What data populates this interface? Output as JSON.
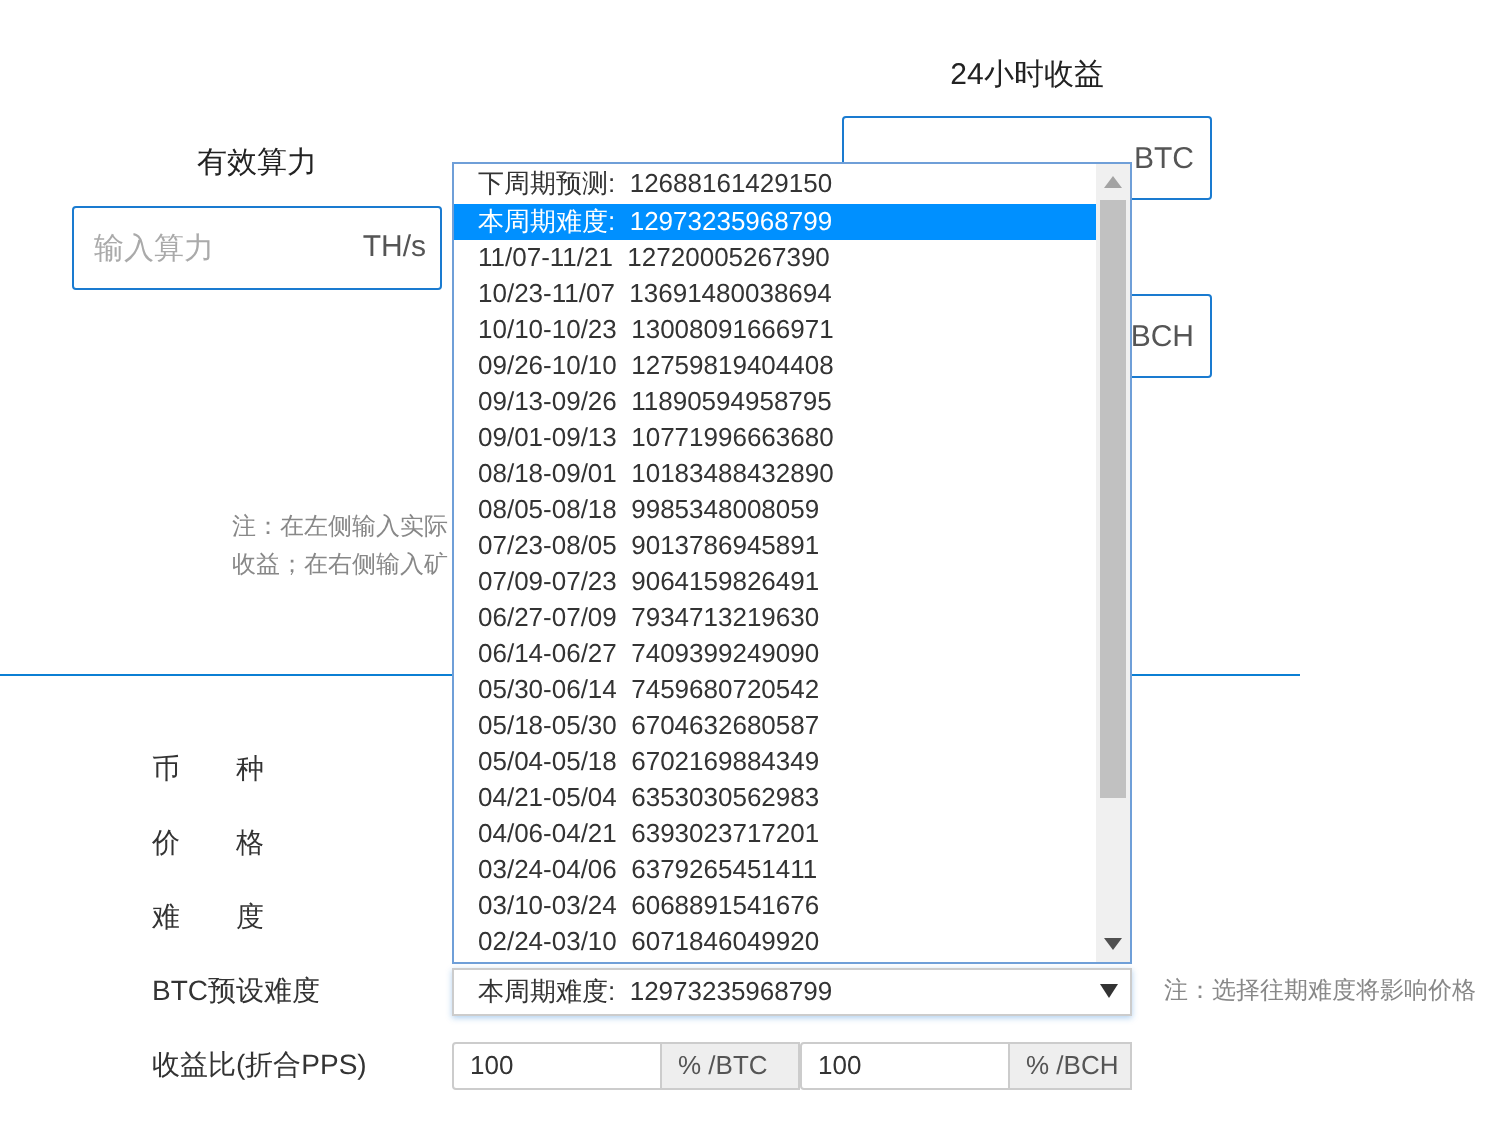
{
  "hashrate": {
    "label": "有效算力",
    "placeholder": "输入算力",
    "unit": "TH/s"
  },
  "revenue": {
    "label": "24小时收益",
    "fields": [
      {
        "unit": "BTC"
      },
      {
        "unit": "BCH"
      }
    ]
  },
  "note_lines": [
    "注：在左侧输入实际",
    "收益；在右侧输入矿"
  ],
  "form": {
    "rows": [
      {
        "label": "币　　种"
      },
      {
        "label": "价　　格"
      },
      {
        "label": "难　　度"
      }
    ]
  },
  "difficulty_select": {
    "label": "BTC预设难度",
    "value": "本周期难度:  12973235968799",
    "note": "注：选择往期难度将影响价格",
    "options": [
      {
        "text": "下周期预测:  12688161429150",
        "selected": false
      },
      {
        "text": "本周期难度:  12973235968799",
        "selected": true
      },
      {
        "text": "11/07-11/21  12720005267390",
        "selected": false
      },
      {
        "text": "10/23-11/07  13691480038694",
        "selected": false
      },
      {
        "text": "10/10-10/23  13008091666971",
        "selected": false
      },
      {
        "text": "09/26-10/10  12759819404408",
        "selected": false
      },
      {
        "text": "09/13-09/26  11890594958795",
        "selected": false
      },
      {
        "text": "09/01-09/13  10771996663680",
        "selected": false
      },
      {
        "text": "08/18-09/01  10183488432890",
        "selected": false
      },
      {
        "text": "08/05-08/18  9985348008059",
        "selected": false
      },
      {
        "text": "07/23-08/05  9013786945891",
        "selected": false
      },
      {
        "text": "07/09-07/23  9064159826491",
        "selected": false
      },
      {
        "text": "06/27-07/09  7934713219630",
        "selected": false
      },
      {
        "text": "06/14-06/27  7409399249090",
        "selected": false
      },
      {
        "text": "05/30-06/14  7459680720542",
        "selected": false
      },
      {
        "text": "05/18-05/30  6704632680587",
        "selected": false
      },
      {
        "text": "05/04-05/18  6702169884349",
        "selected": false
      },
      {
        "text": "04/21-05/04  6353030562983",
        "selected": false
      },
      {
        "text": "04/06-04/21  6393023717201",
        "selected": false
      },
      {
        "text": "03/24-04/06  6379265451411",
        "selected": false
      },
      {
        "text": "03/10-03/24  6068891541676",
        "selected": false
      },
      {
        "text": "02/24-03/10  6071846049920",
        "selected": false
      }
    ]
  },
  "ratio": {
    "label": "收益比(折合PPS)",
    "fields": [
      {
        "value": "100",
        "unit": "% /BTC"
      },
      {
        "value": "100",
        "unit": "% /BCH"
      }
    ]
  }
}
